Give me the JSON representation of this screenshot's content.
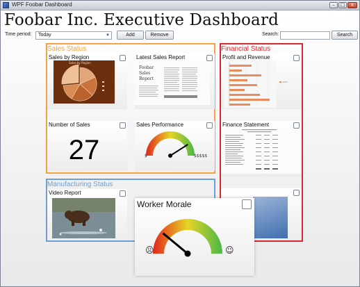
{
  "window": {
    "title": "WPF Foobar Dashboard",
    "controls": {
      "minimize": "–",
      "maximize": "□",
      "close": "x"
    }
  },
  "header": {
    "title": "Foobar Inc. Executive Dashboard"
  },
  "toolbar": {
    "time_period_label": "Time period:",
    "time_period_value": "Today",
    "add_label": "Add",
    "remove_label": "Remove",
    "search_label": "Search:",
    "search_value": "",
    "search_button_label": "Search"
  },
  "groups": {
    "sales": {
      "title": "Sales Status",
      "color": "#f5a341"
    },
    "financial": {
      "title": "Financial Status",
      "color": "#d9282d"
    },
    "manufacturing": {
      "title": "Manufacturing Status",
      "color": "#6d9fd6"
    }
  },
  "tiles": {
    "sales_by_region": {
      "title": "Sales by Region",
      "chart_title": "Sales by Region"
    },
    "latest_sales_report": {
      "title": "Latest Sales Report",
      "report_title_lines": [
        "Foobar",
        "Sales",
        "Report"
      ]
    },
    "number_of_sales": {
      "title": "Number of Sales",
      "value": "27"
    },
    "sales_performance": {
      "title": "Sales Performance",
      "left_label": "$",
      "right_label": "$$$$$"
    },
    "profit_and_revenue": {
      "title": "Profit and Revenue"
    },
    "finance_statement": {
      "title": "Finance Statement"
    },
    "video_report": {
      "title": "Video Report"
    },
    "worker_morale": {
      "title": "Worker Morale",
      "sad_glyph": "☹",
      "happy_glyph": "☺"
    }
  },
  "gauges": {
    "sales_performance_level": 0.82,
    "worker_morale_level": 0.22
  },
  "colors": {
    "pie_background": "#6b2f0e",
    "gauge_red": "#e1261c",
    "gauge_yellow": "#e7d425",
    "gauge_green": "#49b848",
    "bar_color": "#e88c5c"
  }
}
